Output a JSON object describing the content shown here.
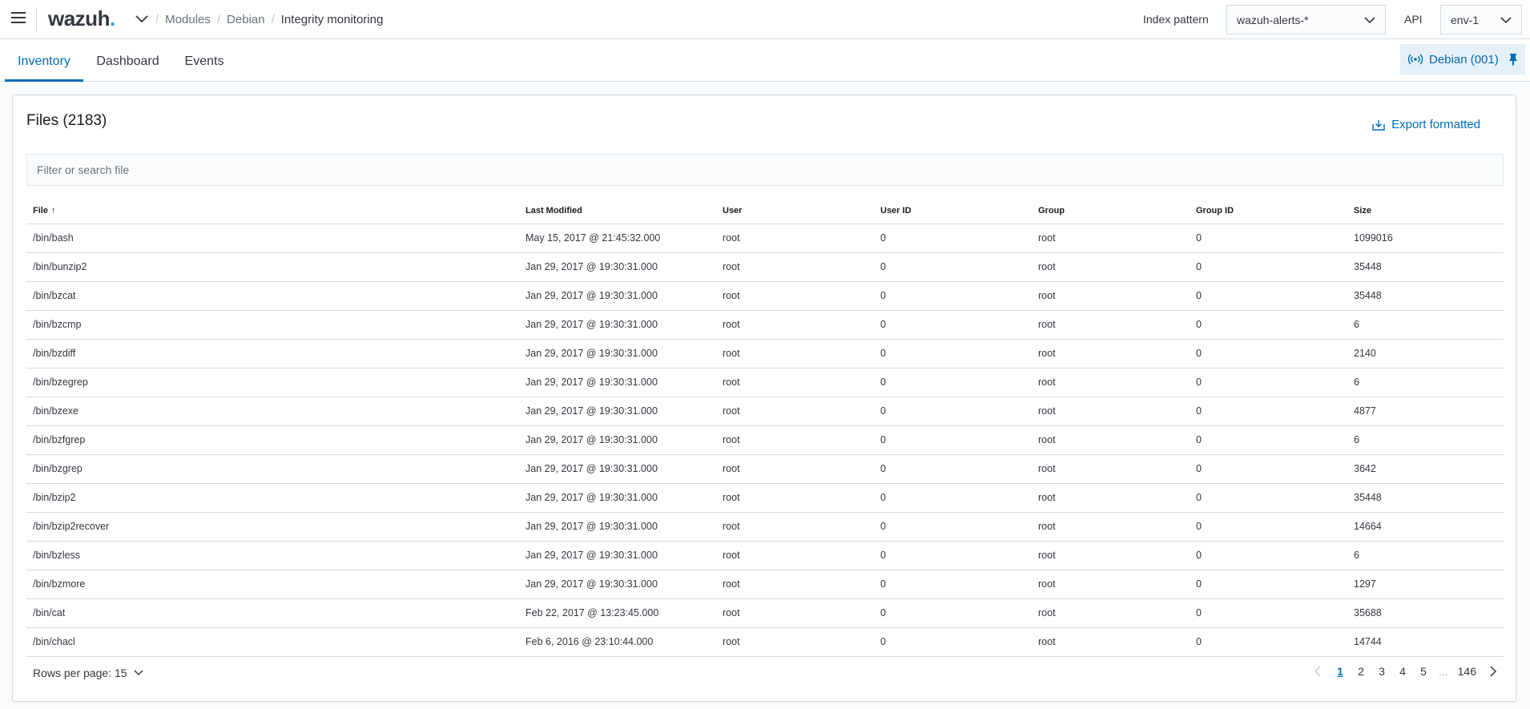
{
  "header": {
    "logo_text": "wazuh",
    "logo_dot": ".",
    "breadcrumbs": [
      "Modules",
      "Debian",
      "Integrity monitoring"
    ],
    "index_pattern_label": "Index pattern",
    "index_pattern_value": "wazuh-alerts-*",
    "api_label": "API",
    "api_value": "env-1"
  },
  "tabs": [
    {
      "label": "Inventory",
      "active": true
    },
    {
      "label": "Dashboard",
      "active": false
    },
    {
      "label": "Events",
      "active": false
    }
  ],
  "agent_button": {
    "label": "Debian (001)"
  },
  "panel": {
    "title": "Files (2183)",
    "export_label": "Export formatted",
    "filter_placeholder": "Filter or search file"
  },
  "table": {
    "columns": [
      "File",
      "Last Modified",
      "User",
      "User ID",
      "Group",
      "Group ID",
      "Size"
    ],
    "sort_indicator": "↑",
    "rows": [
      [
        "/bin/bash",
        "May 15, 2017 @ 21:45:32.000",
        "root",
        "0",
        "root",
        "0",
        "1099016"
      ],
      [
        "/bin/bunzip2",
        "Jan 29, 2017 @ 19:30:31.000",
        "root",
        "0",
        "root",
        "0",
        "35448"
      ],
      [
        "/bin/bzcat",
        "Jan 29, 2017 @ 19:30:31.000",
        "root",
        "0",
        "root",
        "0",
        "35448"
      ],
      [
        "/bin/bzcmp",
        "Jan 29, 2017 @ 19:30:31.000",
        "root",
        "0",
        "root",
        "0",
        "6"
      ],
      [
        "/bin/bzdiff",
        "Jan 29, 2017 @ 19:30:31.000",
        "root",
        "0",
        "root",
        "0",
        "2140"
      ],
      [
        "/bin/bzegrep",
        "Jan 29, 2017 @ 19:30:31.000",
        "root",
        "0",
        "root",
        "0",
        "6"
      ],
      [
        "/bin/bzexe",
        "Jan 29, 2017 @ 19:30:31.000",
        "root",
        "0",
        "root",
        "0",
        "4877"
      ],
      [
        "/bin/bzfgrep",
        "Jan 29, 2017 @ 19:30:31.000",
        "root",
        "0",
        "root",
        "0",
        "6"
      ],
      [
        "/bin/bzgrep",
        "Jan 29, 2017 @ 19:30:31.000",
        "root",
        "0",
        "root",
        "0",
        "3642"
      ],
      [
        "/bin/bzip2",
        "Jan 29, 2017 @ 19:30:31.000",
        "root",
        "0",
        "root",
        "0",
        "35448"
      ],
      [
        "/bin/bzip2recover",
        "Jan 29, 2017 @ 19:30:31.000",
        "root",
        "0",
        "root",
        "0",
        "14664"
      ],
      [
        "/bin/bzless",
        "Jan 29, 2017 @ 19:30:31.000",
        "root",
        "0",
        "root",
        "0",
        "6"
      ],
      [
        "/bin/bzmore",
        "Jan 29, 2017 @ 19:30:31.000",
        "root",
        "0",
        "root",
        "0",
        "1297"
      ],
      [
        "/bin/cat",
        "Feb 22, 2017 @ 13:23:45.000",
        "root",
        "0",
        "root",
        "0",
        "35688"
      ],
      [
        "/bin/chacl",
        "Feb 6, 2016 @ 23:10:44.000",
        "root",
        "0",
        "root",
        "0",
        "14744"
      ]
    ]
  },
  "pagination": {
    "rows_per_page_label": "Rows per page: 15",
    "pages": [
      "1",
      "2",
      "3",
      "4",
      "5"
    ],
    "ellipsis": "...",
    "last_page": "146",
    "current_page": "1"
  },
  "colors": {
    "accent": "#006bb4",
    "logo_dot": "#3595f9",
    "border": "#d3dae6"
  }
}
